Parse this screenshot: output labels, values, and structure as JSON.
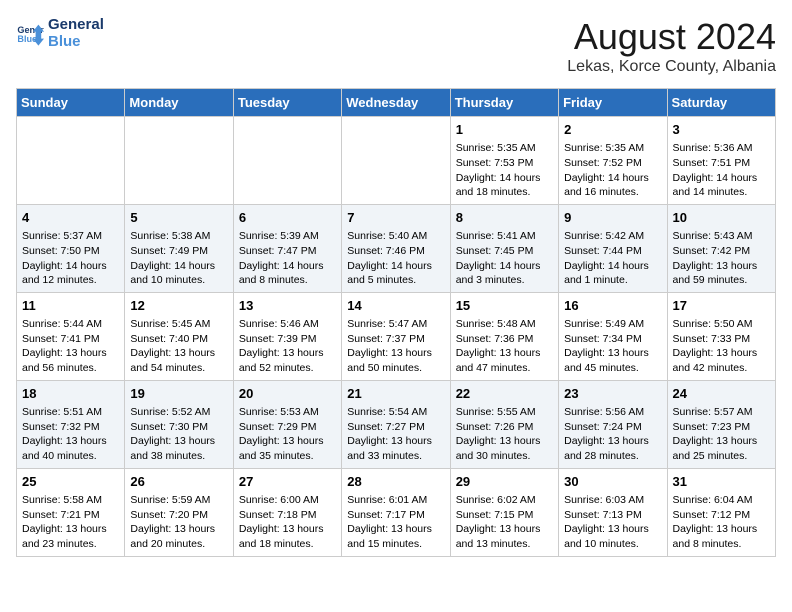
{
  "logo": {
    "line1": "General",
    "line2": "Blue"
  },
  "title": "August 2024",
  "location": "Lekas, Korce County, Albania",
  "weekdays": [
    "Sunday",
    "Monday",
    "Tuesday",
    "Wednesday",
    "Thursday",
    "Friday",
    "Saturday"
  ],
  "weeks": [
    [
      {
        "day": "",
        "info": ""
      },
      {
        "day": "",
        "info": ""
      },
      {
        "day": "",
        "info": ""
      },
      {
        "day": "",
        "info": ""
      },
      {
        "day": "1",
        "info": "Sunrise: 5:35 AM\nSunset: 7:53 PM\nDaylight: 14 hours\nand 18 minutes."
      },
      {
        "day": "2",
        "info": "Sunrise: 5:35 AM\nSunset: 7:52 PM\nDaylight: 14 hours\nand 16 minutes."
      },
      {
        "day": "3",
        "info": "Sunrise: 5:36 AM\nSunset: 7:51 PM\nDaylight: 14 hours\nand 14 minutes."
      }
    ],
    [
      {
        "day": "4",
        "info": "Sunrise: 5:37 AM\nSunset: 7:50 PM\nDaylight: 14 hours\nand 12 minutes."
      },
      {
        "day": "5",
        "info": "Sunrise: 5:38 AM\nSunset: 7:49 PM\nDaylight: 14 hours\nand 10 minutes."
      },
      {
        "day": "6",
        "info": "Sunrise: 5:39 AM\nSunset: 7:47 PM\nDaylight: 14 hours\nand 8 minutes."
      },
      {
        "day": "7",
        "info": "Sunrise: 5:40 AM\nSunset: 7:46 PM\nDaylight: 14 hours\nand 5 minutes."
      },
      {
        "day": "8",
        "info": "Sunrise: 5:41 AM\nSunset: 7:45 PM\nDaylight: 14 hours\nand 3 minutes."
      },
      {
        "day": "9",
        "info": "Sunrise: 5:42 AM\nSunset: 7:44 PM\nDaylight: 14 hours\nand 1 minute."
      },
      {
        "day": "10",
        "info": "Sunrise: 5:43 AM\nSunset: 7:42 PM\nDaylight: 13 hours\nand 59 minutes."
      }
    ],
    [
      {
        "day": "11",
        "info": "Sunrise: 5:44 AM\nSunset: 7:41 PM\nDaylight: 13 hours\nand 56 minutes."
      },
      {
        "day": "12",
        "info": "Sunrise: 5:45 AM\nSunset: 7:40 PM\nDaylight: 13 hours\nand 54 minutes."
      },
      {
        "day": "13",
        "info": "Sunrise: 5:46 AM\nSunset: 7:39 PM\nDaylight: 13 hours\nand 52 minutes."
      },
      {
        "day": "14",
        "info": "Sunrise: 5:47 AM\nSunset: 7:37 PM\nDaylight: 13 hours\nand 50 minutes."
      },
      {
        "day": "15",
        "info": "Sunrise: 5:48 AM\nSunset: 7:36 PM\nDaylight: 13 hours\nand 47 minutes."
      },
      {
        "day": "16",
        "info": "Sunrise: 5:49 AM\nSunset: 7:34 PM\nDaylight: 13 hours\nand 45 minutes."
      },
      {
        "day": "17",
        "info": "Sunrise: 5:50 AM\nSunset: 7:33 PM\nDaylight: 13 hours\nand 42 minutes."
      }
    ],
    [
      {
        "day": "18",
        "info": "Sunrise: 5:51 AM\nSunset: 7:32 PM\nDaylight: 13 hours\nand 40 minutes."
      },
      {
        "day": "19",
        "info": "Sunrise: 5:52 AM\nSunset: 7:30 PM\nDaylight: 13 hours\nand 38 minutes."
      },
      {
        "day": "20",
        "info": "Sunrise: 5:53 AM\nSunset: 7:29 PM\nDaylight: 13 hours\nand 35 minutes."
      },
      {
        "day": "21",
        "info": "Sunrise: 5:54 AM\nSunset: 7:27 PM\nDaylight: 13 hours\nand 33 minutes."
      },
      {
        "day": "22",
        "info": "Sunrise: 5:55 AM\nSunset: 7:26 PM\nDaylight: 13 hours\nand 30 minutes."
      },
      {
        "day": "23",
        "info": "Sunrise: 5:56 AM\nSunset: 7:24 PM\nDaylight: 13 hours\nand 28 minutes."
      },
      {
        "day": "24",
        "info": "Sunrise: 5:57 AM\nSunset: 7:23 PM\nDaylight: 13 hours\nand 25 minutes."
      }
    ],
    [
      {
        "day": "25",
        "info": "Sunrise: 5:58 AM\nSunset: 7:21 PM\nDaylight: 13 hours\nand 23 minutes."
      },
      {
        "day": "26",
        "info": "Sunrise: 5:59 AM\nSunset: 7:20 PM\nDaylight: 13 hours\nand 20 minutes."
      },
      {
        "day": "27",
        "info": "Sunrise: 6:00 AM\nSunset: 7:18 PM\nDaylight: 13 hours\nand 18 minutes."
      },
      {
        "day": "28",
        "info": "Sunrise: 6:01 AM\nSunset: 7:17 PM\nDaylight: 13 hours\nand 15 minutes."
      },
      {
        "day": "29",
        "info": "Sunrise: 6:02 AM\nSunset: 7:15 PM\nDaylight: 13 hours\nand 13 minutes."
      },
      {
        "day": "30",
        "info": "Sunrise: 6:03 AM\nSunset: 7:13 PM\nDaylight: 13 hours\nand 10 minutes."
      },
      {
        "day": "31",
        "info": "Sunrise: 6:04 AM\nSunset: 7:12 PM\nDaylight: 13 hours\nand 8 minutes."
      }
    ]
  ]
}
